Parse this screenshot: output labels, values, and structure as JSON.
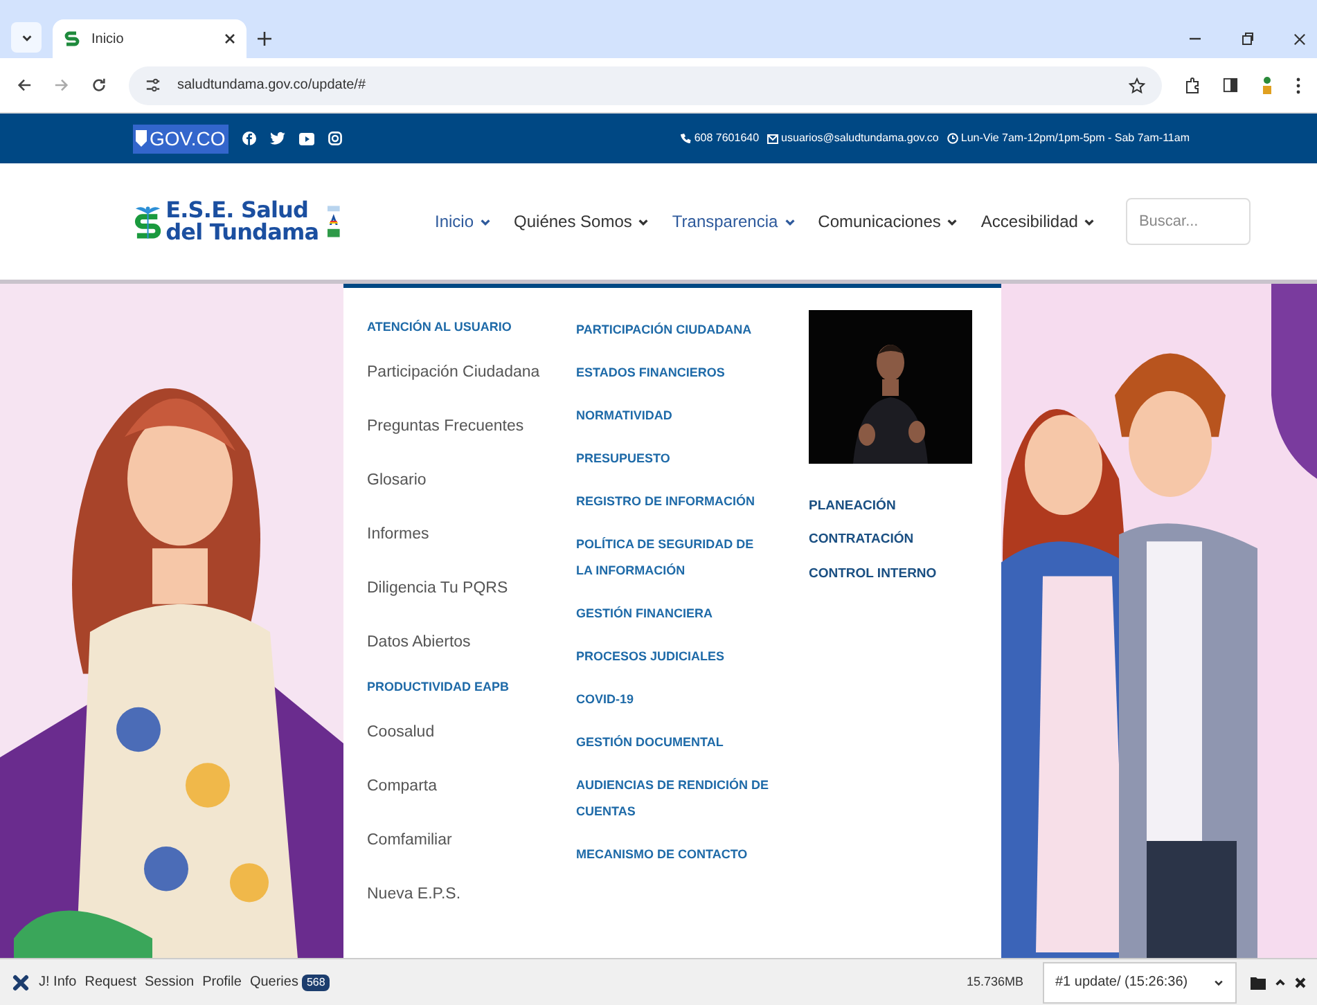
{
  "browser": {
    "tab_title": "Inicio",
    "url": "saludtundama.gov.co/update/#"
  },
  "top_bar": {
    "brand": "GOV.CO",
    "phone": "608 7601640",
    "email": "usuarios@saludtundama.gov.co",
    "hours": "Lun-Vie 7am-12pm/1pm-5pm - Sab 7am-11am"
  },
  "header": {
    "logo_line1": "E.S.E. Salud",
    "logo_line2": "del Tundama",
    "search": {
      "placeholder": "Buscar..."
    },
    "nav": [
      {
        "label": "Inicio",
        "selected": true
      },
      {
        "label": "Quiénes Somos",
        "selected": false
      },
      {
        "label": "Transparencia",
        "selected": true
      },
      {
        "label": "Comunicaciones",
        "selected": false
      },
      {
        "label": "Accesibilidad",
        "selected": false
      }
    ]
  },
  "mega_menu": {
    "column_1": [
      {
        "kind": "heading",
        "text": "ATENCIÓN AL USUARIO"
      },
      {
        "kind": "link",
        "text": "Participación Ciudadana"
      },
      {
        "kind": "link",
        "text": "Preguntas Frecuentes"
      },
      {
        "kind": "link",
        "text": "Glosario"
      },
      {
        "kind": "link",
        "text": "Informes"
      },
      {
        "kind": "link",
        "text": "Diligencia Tu PQRS"
      },
      {
        "kind": "link",
        "text": "Datos Abiertos"
      },
      {
        "kind": "heading",
        "text": "PRODUCTIVIDAD EAPB"
      },
      {
        "kind": "link",
        "text": "Coosalud"
      },
      {
        "kind": "link",
        "text": "Comparta"
      },
      {
        "kind": "link",
        "text": "Comfamiliar"
      },
      {
        "kind": "link",
        "text": "Nueva E.P.S."
      }
    ],
    "column_2": [
      "PARTICIPACIÓN CIUDADANA",
      "ESTADOS FINANCIEROS",
      "NORMATIVIDAD",
      "PRESUPUESTO",
      "REGISTRO DE INFORMACIÓN",
      "POLÍTICA DE SEGURIDAD DE LA INFORMACIÓN",
      "GESTIÓN FINANCIERA",
      "PROCESOS JUDICIALES",
      "COVID-19",
      "GESTIÓN DOCUMENTAL",
      "AUDIENCIAS DE RENDICIÓN DE CUENTAS",
      "MECANISMO DE CONTACTO"
    ],
    "column_3": {
      "links": [
        "PLANEACIÓN",
        "CONTRATACIÓN",
        "CONTROL INTERNO"
      ]
    }
  },
  "debug_bar": {
    "items": [
      "J! Info",
      "Request",
      "Session",
      "Profile"
    ],
    "queries_label": "Queries",
    "queries_count": "568",
    "memory": "15.736MB",
    "request_select": "#1 update/ (15:26:36)"
  }
}
